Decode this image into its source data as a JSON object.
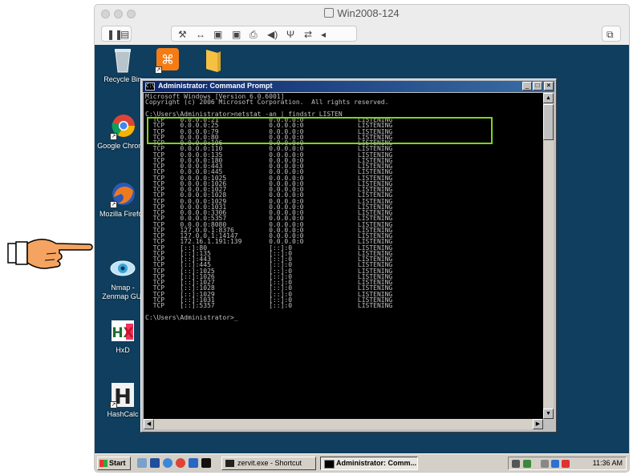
{
  "window": {
    "title": "Win2008-124"
  },
  "desktop_icons": [
    {
      "label": "Recycle Bin"
    },
    {
      "label": "Google Chrome"
    },
    {
      "label": "Mozilla Firefox"
    },
    {
      "label": "Nmap -",
      "label2": "Zenmap GUI"
    },
    {
      "label": "HxD"
    },
    {
      "label": "HashCalc"
    }
  ],
  "cmd": {
    "title": "Administrator: Command Prompt",
    "output": "Microsoft Windows [Version 6.0.6001]\nCopyright (c) 2006 Microsoft Corporation.  All rights reserved.\n\nC:\\Users\\Administrator>netstat -an | findstr LISTEN\n  TCP    0.0.0.0:21             0.0.0.0:0              LISTENING\n  TCP    0.0.0.0:25             0.0.0.0:0              LISTENING\n  TCP    0.0.0.0:79             0.0.0.0:0              LISTENING\n  TCP    0.0.0.0:80             0.0.0.0:0              LISTENING\n  TCP    0.0.0.0:106            0.0.0.0:0              LISTENING\n  TCP    0.0.0.0:110            0.0.0.0:0              LISTENING\n  TCP    0.0.0.0:135            0.0.0.0:0              LISTENING\n  TCP    0.0.0.0:180            0.0.0.0:0              LISTENING\n  TCP    0.0.0.0:443            0.0.0.0:0              LISTENING\n  TCP    0.0.0.0:445            0.0.0.0:0              LISTENING\n  TCP    0.0.0.0:1025           0.0.0.0:0              LISTENING\n  TCP    0.0.0.0:1026           0.0.0.0:0              LISTENING\n  TCP    0.0.0.0:1027           0.0.0.0:0              LISTENING\n  TCP    0.0.0.0:1028           0.0.0.0:0              LISTENING\n  TCP    0.0.0.0:1029           0.0.0.0:0              LISTENING\n  TCP    0.0.0.0:1031           0.0.0.0:0              LISTENING\n  TCP    0.0.0.0:3306           0.0.0.0:0              LISTENING\n  TCP    0.0.0.0:5357           0.0.0.0:0              LISTENING\n  TCP    0.0.0.0:8080           0.0.0.0:0              LISTENING\n  TCP    127.0.0.1:8376         0.0.0.0:0              LISTENING\n  TCP    127.0.0.1:14147        0.0.0.0:0              LISTENING\n  TCP    172.16.1.191:139       0.0.0.0:0              LISTENING\n  TCP    [::]:80                [::]:0                 LISTENING\n  TCP    [::]:135               [::]:0                 LISTENING\n  TCP    [::]:443               [::]:0                 LISTENING\n  TCP    [::]:445               [::]:0                 LISTENING\n  TCP    [::]:1025              [::]:0                 LISTENING\n  TCP    [::]:1026              [::]:0                 LISTENING\n  TCP    [::]:1027              [::]:0                 LISTENING\n  TCP    [::]:1028              [::]:0                 LISTENING\n  TCP    [::]:1029              [::]:0                 LISTENING\n  TCP    [::]:1031              [::]:0                 LISTENING\n  TCP    [::]:5357              [::]:0                 LISTENING\n\nC:\\Users\\Administrator>_"
  },
  "taskbar": {
    "start_label": "Start",
    "tasks": [
      {
        "label": "zervit.exe - Shortcut"
      },
      {
        "label": "Administrator: Comm..."
      }
    ],
    "clock": "11:36 AM"
  },
  "colors": {
    "desktop": "#0f3e5e",
    "highlight_box": "#7ed321",
    "title_bar": "#0a246a"
  }
}
